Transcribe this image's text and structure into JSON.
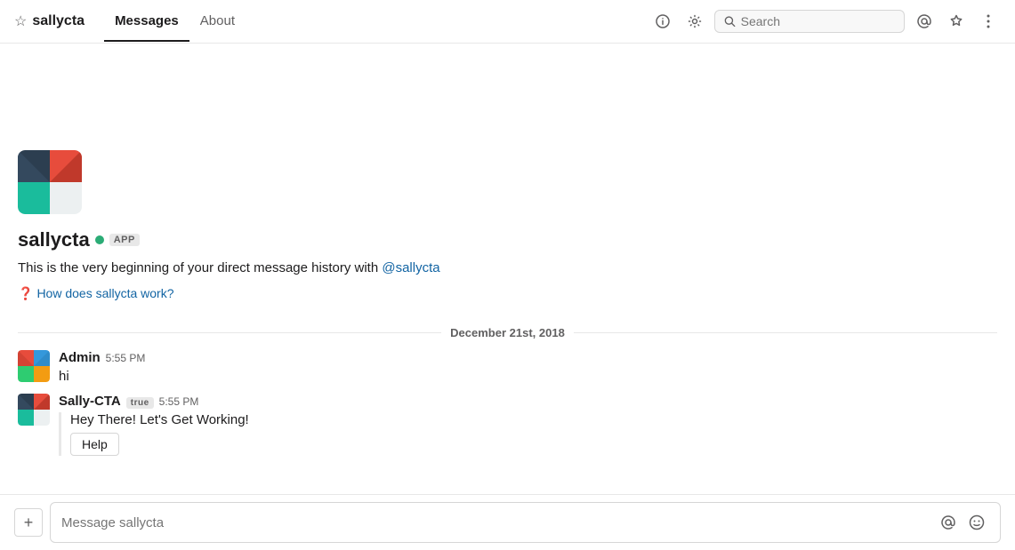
{
  "header": {
    "star_icon": "☆",
    "title": "sallycta",
    "tabs": [
      {
        "label": "Messages",
        "active": true
      },
      {
        "label": "About",
        "active": false
      }
    ],
    "icons": {
      "info": "ℹ",
      "settings": "⚙",
      "at": "@",
      "star": "☆",
      "more": "⋮"
    },
    "search": {
      "placeholder": "Search"
    }
  },
  "channel_intro": {
    "bot_name": "sallycta",
    "online": true,
    "app_badge": "APP",
    "description_pre": "This is the very beginning of your direct message history with",
    "description_link": "@sallycta",
    "help_link": "How does sallycta work?"
  },
  "date_divider": {
    "label": "December 21st, 2018"
  },
  "messages": [
    {
      "id": "msg1",
      "sender": "Admin",
      "time": "5:55 PM",
      "text": "hi",
      "has_attachment": false,
      "app_badge": false
    },
    {
      "id": "msg2",
      "sender": "Sally-CTA",
      "time": "5:55 PM",
      "text": "",
      "has_attachment": true,
      "attachment_text": "Hey There! Let's Get Working!",
      "attachment_button": "Help",
      "app_badge": true
    }
  ],
  "message_input": {
    "placeholder": "Message sallycta",
    "add_icon": "+",
    "at_icon": "@",
    "emoji_icon": "☺"
  }
}
